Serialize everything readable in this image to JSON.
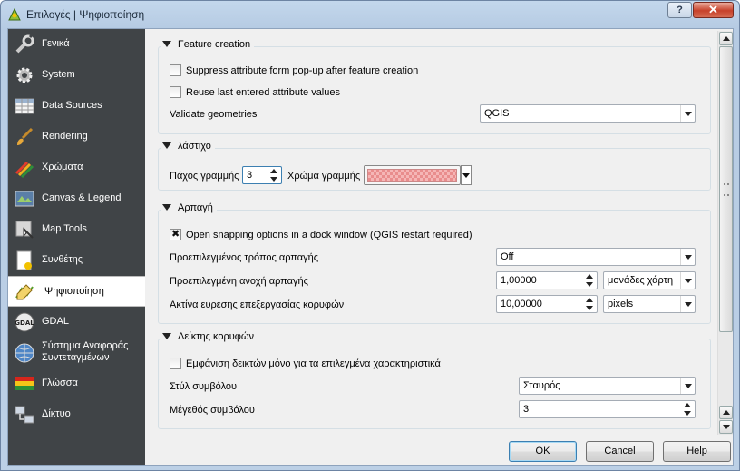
{
  "window": {
    "title": "Επιλογές | Ψηφιοποίηση",
    "help_label": "?",
    "close_label": "✕"
  },
  "sidebar": {
    "items": [
      {
        "label": "Γενικά",
        "icon": "wrench-icon"
      },
      {
        "label": "System",
        "icon": "gear-icon"
      },
      {
        "label": "Data Sources",
        "icon": "table-icon"
      },
      {
        "label": "Rendering",
        "icon": "paintbrush-icon"
      },
      {
        "label": "Χρώματα",
        "icon": "color-pencils-icon"
      },
      {
        "label": "Canvas & Legend",
        "icon": "map-canvas-icon"
      },
      {
        "label": "Map Tools",
        "icon": "map-tools-icon"
      },
      {
        "label": "Συνθέτης",
        "icon": "composer-icon"
      },
      {
        "label": "Ψηφιοποίηση",
        "icon": "digitizing-icon",
        "active": true
      },
      {
        "label": "GDAL",
        "icon": "gdal-icon"
      },
      {
        "label": "Σύστημα Αναφοράς Συντεταγμένων",
        "icon": "globe-icon"
      },
      {
        "label": "Γλώσσα",
        "icon": "flag-icon"
      },
      {
        "label": "Δίκτυο",
        "icon": "network-icon"
      }
    ]
  },
  "feature_creation": {
    "title": "Feature creation",
    "suppress_label": "Suppress attribute form pop-up after feature creation",
    "suppress_checked": false,
    "reuse_label": "Reuse last entered attribute values",
    "reuse_checked": false,
    "validate_label": "Validate geometries",
    "validate_value": "QGIS"
  },
  "rubberband": {
    "title": "λάστιχο",
    "width_label": "Πάχος γραμμής",
    "width_value": "3",
    "color_label": "Χρώμα γραμμής",
    "color": "#f5b6b6"
  },
  "snapping": {
    "title": "Αρπαγή",
    "dock_label": "Open snapping options in a dock window (QGIS restart required)",
    "dock_checked": true,
    "mode_label": "Προεπιλεγμένος τρόπος αρπαγής",
    "mode_value": "Off",
    "tolerance_label": "Προεπιλεγμένη ανοχή αρπαγής",
    "tolerance_value": "1,00000",
    "tolerance_unit": "μονάδες χάρτη",
    "radius_label": "Ακτίνα ευρεσης επεξεργασίας κορυφών",
    "radius_value": "10,00000",
    "radius_unit": "pixels"
  },
  "vertex_markers": {
    "title": "Δείκτης κορυφών",
    "selected_only_label": "Εμφάνιση δεικτών μόνο για τα επιλεγμένα χαρακτηριστικά",
    "selected_only_checked": false,
    "style_label": "Στύλ συμβόλου",
    "style_value": "Σταυρός",
    "size_label": "Μέγεθός συμβόλου",
    "size_value": "3"
  },
  "buttons": {
    "ok": "OK",
    "cancel": "Cancel",
    "help": "Help"
  }
}
